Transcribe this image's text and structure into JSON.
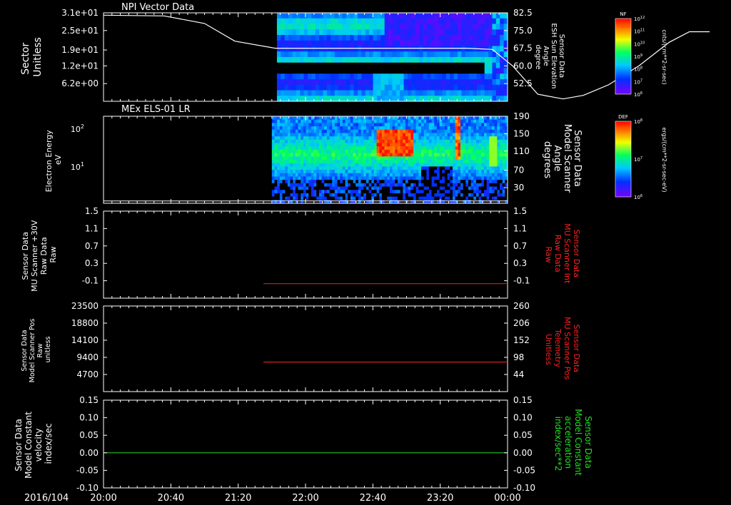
{
  "colors": {
    "background": "#000000",
    "axis": "#ffffff",
    "red_trace": "#cc2222",
    "green_trace": "#22cc22",
    "right_label_red": "#ff2020",
    "right_label_green": "#20e020"
  },
  "time_axis": {
    "date_label": "2016/104",
    "ticks": [
      "20:00",
      "20:40",
      "21:20",
      "22:00",
      "22:40",
      "23:20",
      "00:00"
    ]
  },
  "chart_data": [
    {
      "type": "heatmap",
      "title": "NPI Vector Data",
      "left_axis": {
        "label_lines": [
          "Sector",
          "Unitless"
        ],
        "ticks": [
          "3.1e+01",
          "2.5e+01",
          "1.9e+01",
          "1.2e+01",
          "6.2e+00"
        ]
      },
      "right_axis": {
        "label_lines": [
          "Sensor Data",
          "ESH Sun Elevation",
          "Angle",
          "degree"
        ],
        "ticks": [
          "82.5",
          "75.0",
          "67.5",
          "60.0",
          "52.5"
        ],
        "range": [
          45,
          82.5
        ]
      },
      "data_start": "21:43",
      "line": {
        "x_hours": [
          0.0,
          0.6,
          1.0,
          1.3,
          1.7,
          2.0,
          2.5,
          2.9,
          3.3,
          3.6,
          3.85,
          4.05,
          4.3,
          4.55,
          4.75,
          5.0,
          5.3,
          5.6,
          5.8,
          6.0
        ],
        "y_deg": [
          81.5,
          81.2,
          78.0,
          70.5,
          67.5,
          67.5,
          67.5,
          67.5,
          67.5,
          67.5,
          67.0,
          60.0,
          48.0,
          46.0,
          47.5,
          52.0,
          60.0,
          70.0,
          74.5,
          74.5
        ]
      },
      "colorbar": {
        "title": "NF",
        "ticks": [
          "10^12",
          "10^11",
          "10^10",
          "10^9",
          "10^8",
          "10^7",
          "10^6"
        ],
        "unit": "cnts/(cm**2-sr-sec)"
      }
    },
    {
      "type": "heatmap",
      "title": "MEx ELS-01 LR",
      "left_axis": {
        "label_lines": [
          "Electron Energy",
          "eV"
        ],
        "ticks": [
          "10^2",
          "10^1"
        ]
      },
      "right_axis": {
        "label_lines": [
          "Sensor Data",
          "Model Scanner",
          "Angle",
          "degrees"
        ],
        "ticks": [
          "190",
          "150",
          "110",
          "70",
          "30"
        ],
        "range": [
          0,
          190
        ]
      },
      "data_start": "21:40",
      "line": {
        "y_value": 5
      },
      "colorbar": {
        "title": "DEF",
        "ticks": [
          "10^8",
          "10^7",
          "10^6"
        ],
        "unit": "ergs/(cm**2-sr-sec-eV)"
      }
    },
    {
      "type": "line",
      "left_axis": {
        "label_lines": [
          "Sensor Data",
          "MU Scanner +30V",
          "Raw Data",
          "Raw"
        ],
        "ticks": [
          "1.5",
          "1.1",
          "0.7",
          "0.3",
          "-0.1"
        ],
        "range": [
          -0.3,
          1.5
        ]
      },
      "right_axis": {
        "label_lines": [
          "Sensor Data",
          "MU Scanner Int",
          "Raw Data",
          "Raw"
        ],
        "ticks": [
          "1.5",
          "1.1",
          "0.7",
          "0.3",
          "-0.1"
        ]
      },
      "series": [
        {
          "x_start": "21:35",
          "x_end": "00:00",
          "y": 0.0
        }
      ]
    },
    {
      "type": "line",
      "left_axis": {
        "label_lines": [
          "Sensor Data",
          "Model Scanner Pos",
          "Raw",
          "unitless"
        ],
        "ticks": [
          "23500",
          "18800",
          "14100",
          "9400",
          "4700"
        ],
        "range": [
          0,
          23500
        ]
      },
      "right_axis": {
        "label_lines": [
          "Sensor Data",
          "MU Scanner Pos",
          "Telemetry",
          "Unitless"
        ],
        "ticks": [
          "260",
          "206",
          "152",
          "98",
          "44"
        ]
      },
      "series": [
        {
          "x_start": "21:35",
          "x_end": "00:00",
          "y": 8100
        }
      ]
    },
    {
      "type": "line",
      "left_axis": {
        "label_lines": [
          "Sensor Data",
          "Model Constant",
          "velocity",
          "index/sec"
        ],
        "ticks": [
          "0.15",
          "0.10",
          "0.05",
          "0.00",
          "-0.05",
          "-0.10"
        ],
        "range": [
          -0.1,
          0.15
        ]
      },
      "right_axis": {
        "label_lines": [
          "Sensor Data",
          "Model Constant",
          "acceleration",
          "index/sec**2"
        ],
        "ticks": [
          "0.15",
          "0.10",
          "0.05",
          "0.00",
          "-0.05",
          "-0.10"
        ]
      },
      "series": [
        {
          "x_start": "20:00",
          "x_end": "00:00",
          "y": 0.0
        }
      ]
    }
  ]
}
